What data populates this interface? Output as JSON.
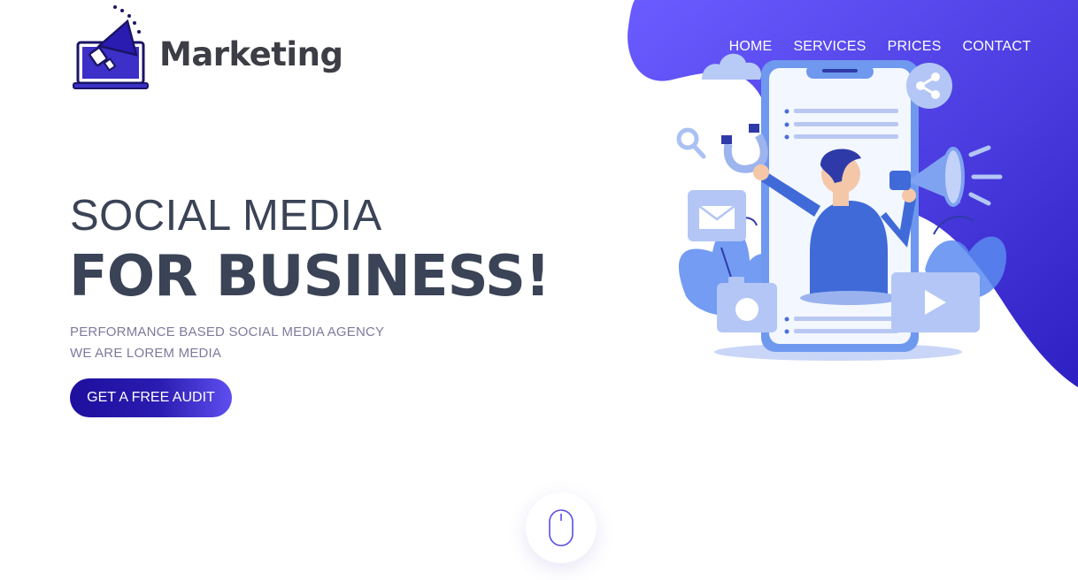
{
  "brand": {
    "name": "Marketing",
    "accent": "#2a1cb0",
    "blob_color": "#5b4cf0"
  },
  "nav": {
    "items": [
      "HOME",
      "SERVICES",
      "PRICES",
      "CONTACT"
    ]
  },
  "hero": {
    "line1": "SOCIAL MEDIA",
    "line2": "FOR BUSINESS!",
    "subline1": "PERFORMANCE BASED SOCIAL MEDIA AGENCY",
    "subline2": "WE ARE LOREM MEDIA",
    "cta_label": "GET A FREE AUDIT"
  },
  "icons": {
    "logo": "megaphone-laptop-icon",
    "scroll": "mouse-icon"
  }
}
